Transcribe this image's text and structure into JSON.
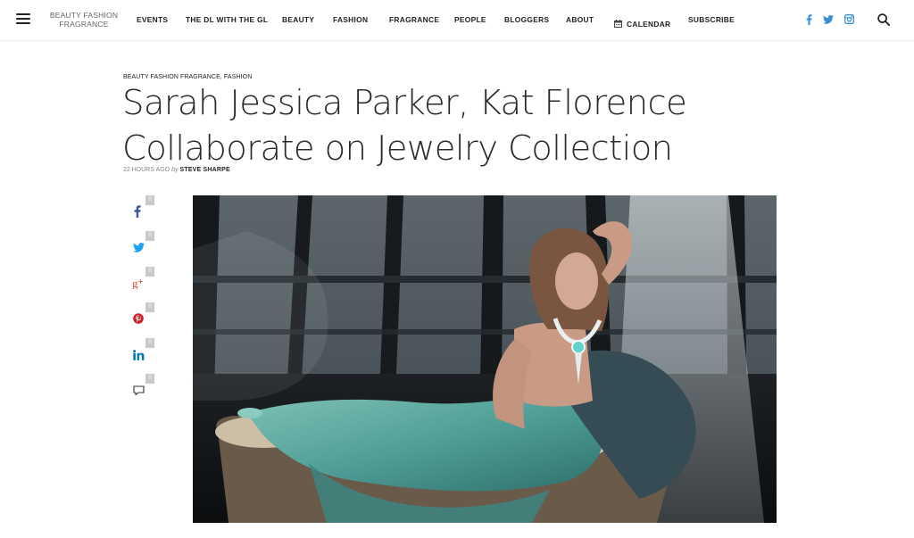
{
  "site": {
    "logo_line1": "BEAUTY FASHION",
    "logo_line2": "FRAGRANCE"
  },
  "nav": {
    "items": [
      {
        "label": "EVENTS"
      },
      {
        "label": "THE DL WITH THE GL"
      },
      {
        "label": "BEAUTY"
      },
      {
        "label": "FASHION"
      },
      {
        "label": "FRAGRANCE"
      },
      {
        "label": "PEOPLE"
      },
      {
        "label": "BLOGGERS"
      },
      {
        "label": "ABOUT"
      },
      {
        "label": "CALENDAR",
        "icon": "calendar-icon"
      },
      {
        "label": "SUBSCRIBE"
      }
    ],
    "social": [
      "facebook-icon",
      "twitter-icon",
      "instagram-icon"
    ],
    "search_icon": "search-icon"
  },
  "article": {
    "categories": "BEAUTY FASHION FRAGRANCE, FASHION",
    "title_line1": "Sarah Jessica Parker, Kat Florence",
    "title_line2": "Collaborate on Jewelry Collection",
    "time_ago": "22 HOURS AGO",
    "by": "by",
    "author": "STEVE SHARPE"
  },
  "share": [
    {
      "icon": "facebook-icon",
      "count": "0"
    },
    {
      "icon": "twitter-icon",
      "count": "0"
    },
    {
      "icon": "google-plus-icon",
      "count": "0"
    },
    {
      "icon": "pinterest-icon",
      "count": "0"
    },
    {
      "icon": "linkedin-icon",
      "count": "0"
    },
    {
      "icon": "comment-icon",
      "count": "0"
    }
  ],
  "colors": {
    "facebook": "#3b5998",
    "twitter": "#1da1f2",
    "google_plus": "#dd4b39",
    "pinterest": "#cb2027",
    "linkedin": "#0077b5",
    "social_top": "#3d8fd1"
  }
}
